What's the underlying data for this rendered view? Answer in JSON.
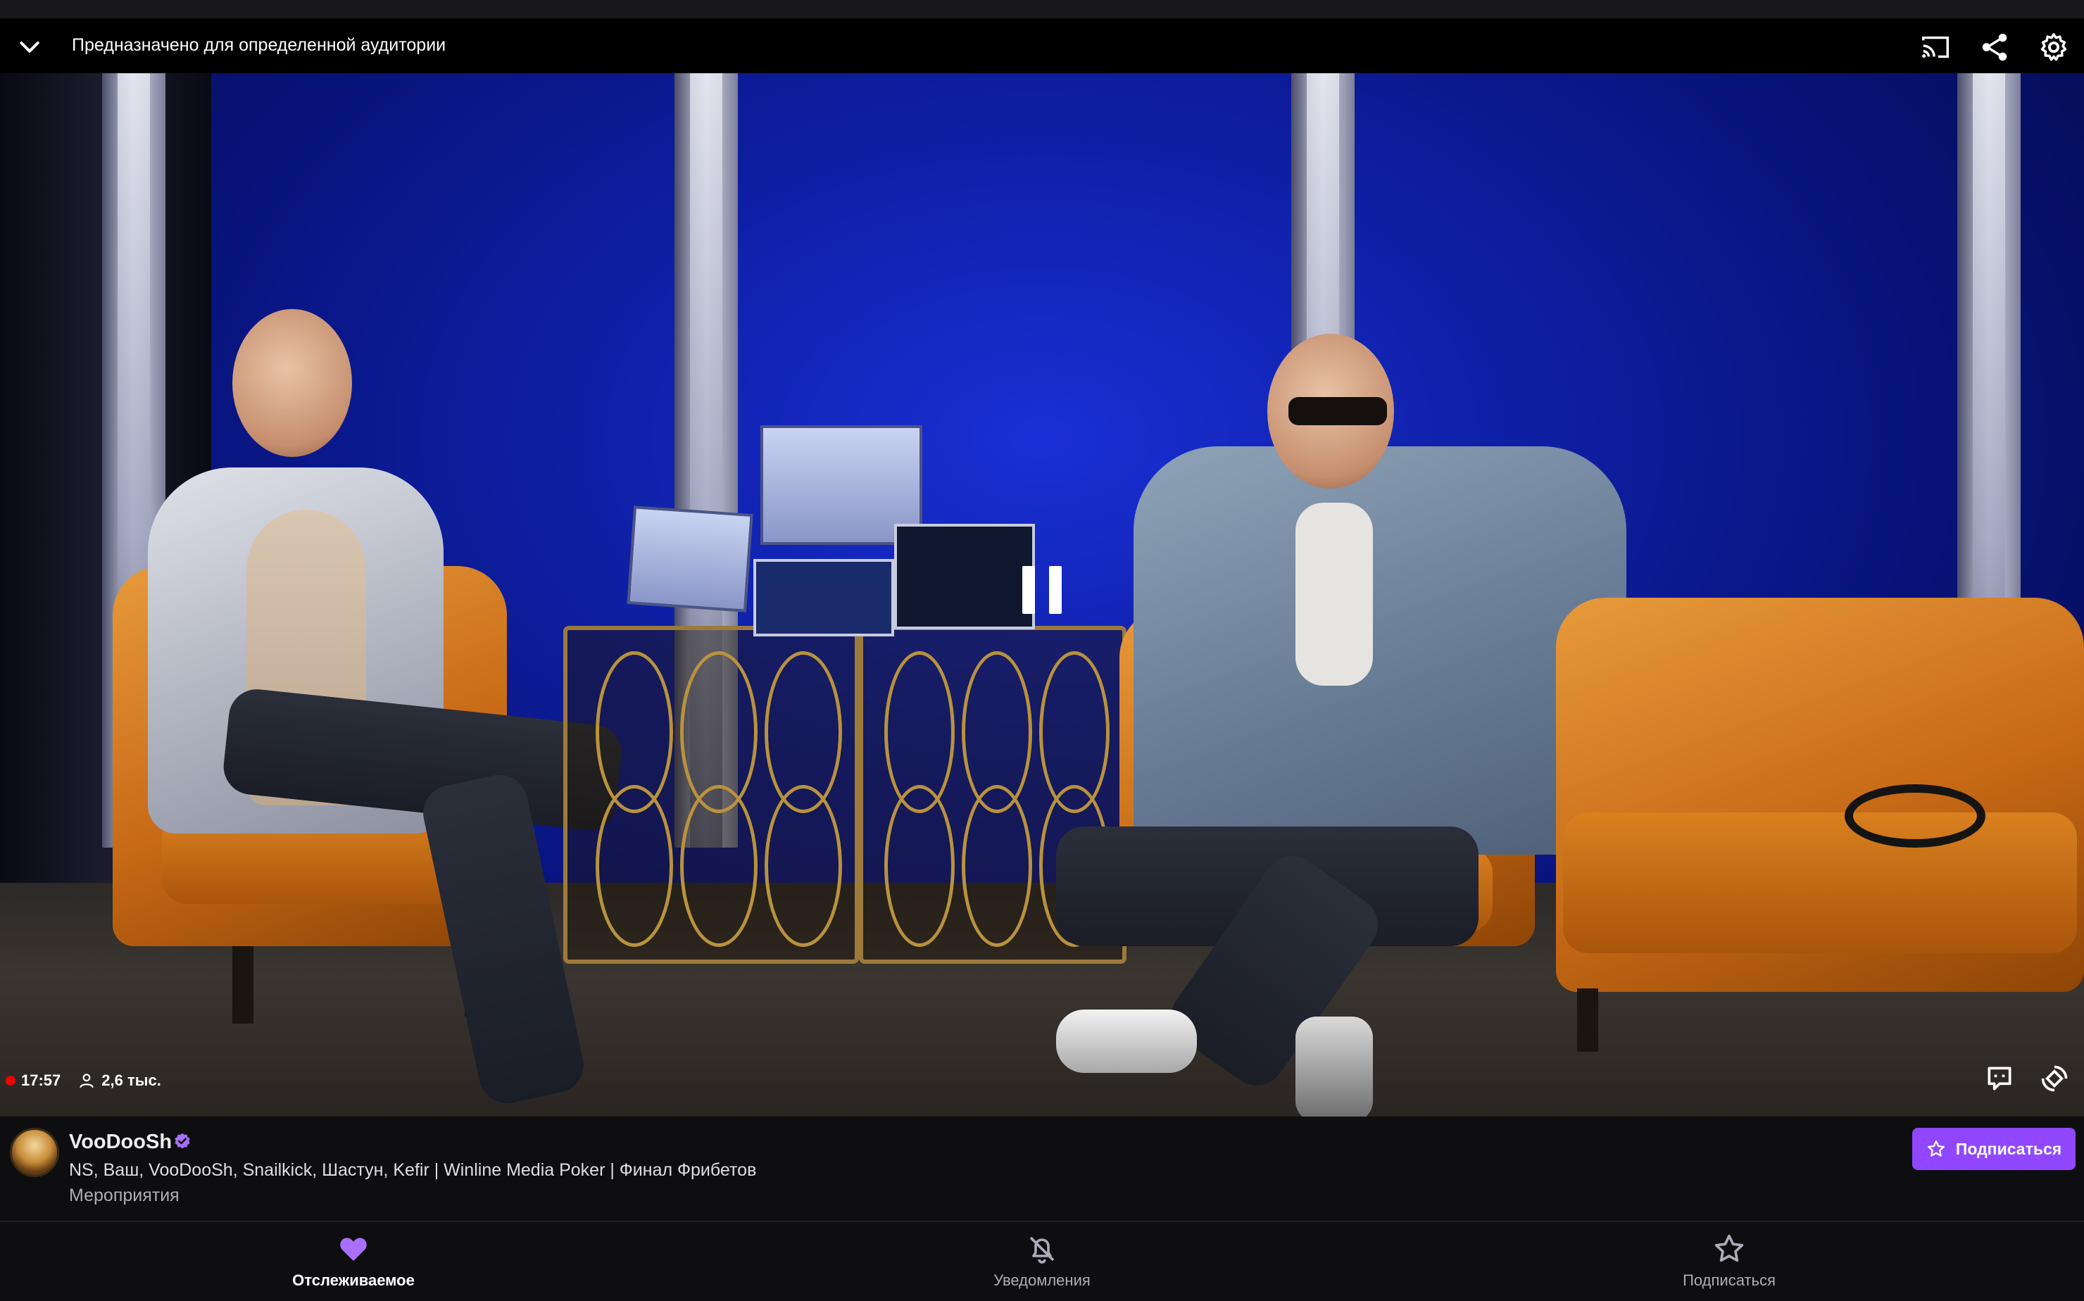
{
  "player": {
    "audience_label": "Предназначено для определенной аудитории",
    "live_time": "17:57",
    "viewers": "2,6 тыс."
  },
  "channel": {
    "name": "VooDooSh",
    "stream_title": "NS, Ваш, VooDooSh, Snailkick, Шастун, Kefir | Winline Media Poker | Финал Фрибетов",
    "category": "Мероприятия",
    "subscribe_label": "Подписаться"
  },
  "nav": {
    "items": [
      {
        "label": "Отслеживаемое",
        "icon": "heart-icon",
        "active": true
      },
      {
        "label": "Уведомления",
        "icon": "bell-off-icon",
        "active": false
      },
      {
        "label": "Подписаться",
        "icon": "star-icon",
        "active": false
      }
    ]
  },
  "colors": {
    "accent": "#9147ff",
    "live": "#eb0400",
    "background": "#0e0e10"
  }
}
